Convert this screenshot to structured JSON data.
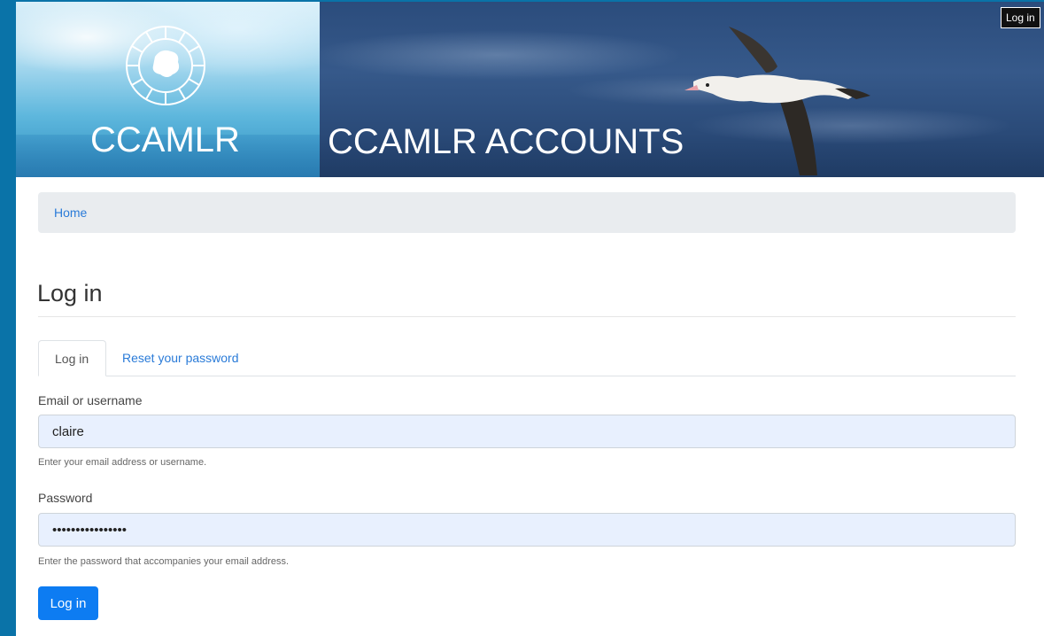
{
  "header": {
    "logo_text": "CCAMLR",
    "site_title": "CCAMLR ACCOUNTS",
    "top_login_label": "Log in"
  },
  "breadcrumb": {
    "home_label": "Home"
  },
  "page": {
    "title": "Log in"
  },
  "tabs": [
    {
      "label": "Log in",
      "active": true
    },
    {
      "label": "Reset your password",
      "active": false
    }
  ],
  "form": {
    "username": {
      "label": "Email or username",
      "value": "claire",
      "help": "Enter your email address or username."
    },
    "password": {
      "label": "Password",
      "value": "claire_password1",
      "help": "Enter the password that accompanies your email address."
    },
    "submit_label": "Log in"
  },
  "colors": {
    "page_border": "#0a73a8",
    "link": "#2a7bd8",
    "primary_button": "#0d7cf2",
    "autofill_bg": "#e8f0fe",
    "breadcrumb_bg": "#e9ecef"
  }
}
